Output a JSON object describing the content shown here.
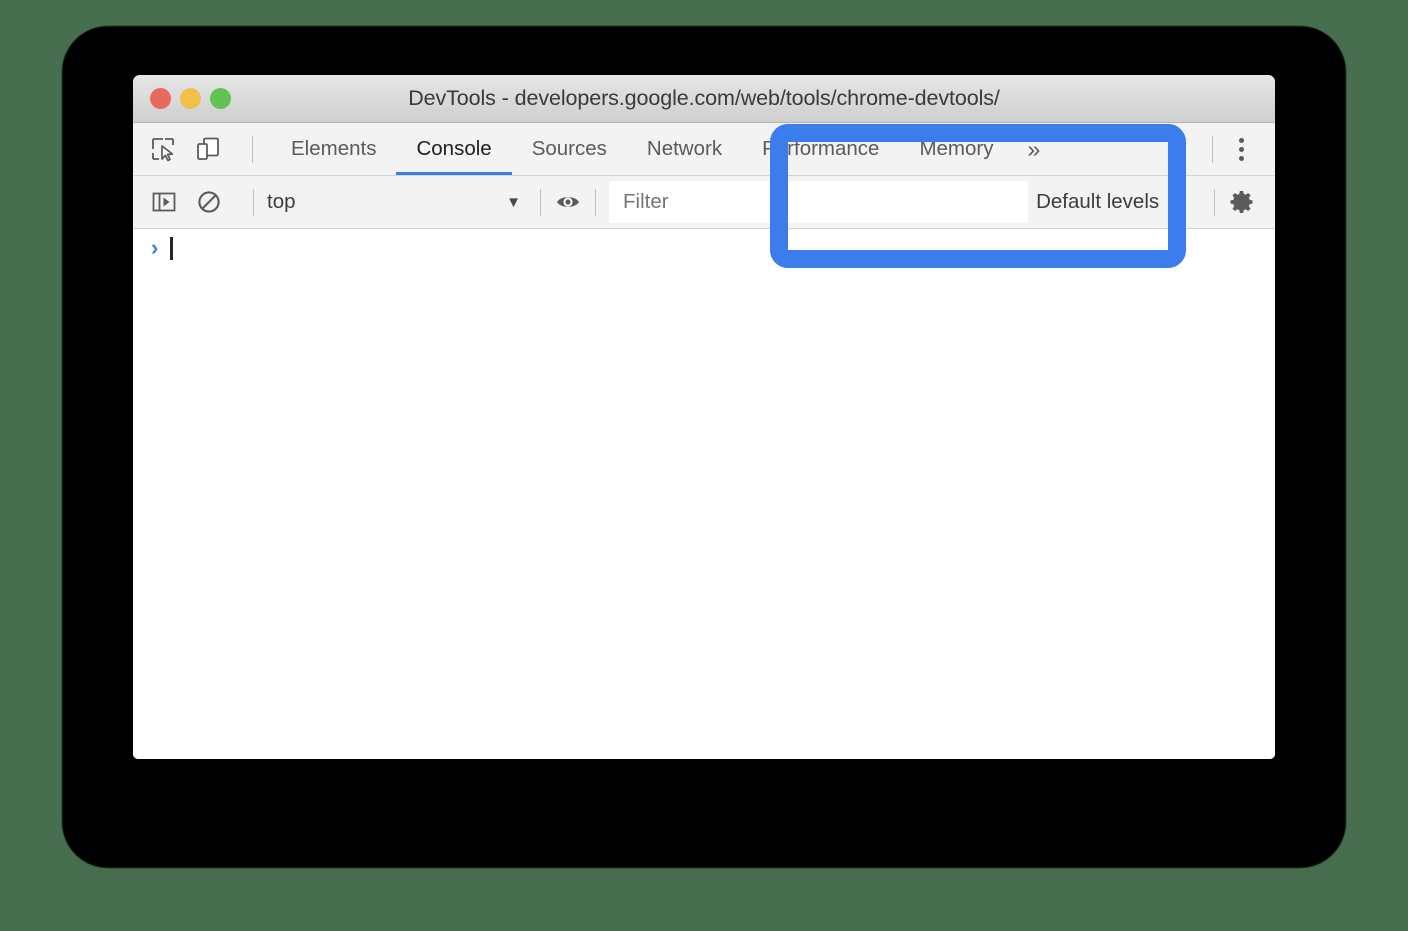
{
  "window": {
    "title": "DevTools - developers.google.com/web/tools/chrome-devtools/",
    "traffic_lights": [
      {
        "name": "close",
        "color": "#e8695e"
      },
      {
        "name": "minimize",
        "color": "#f0bf4c"
      },
      {
        "name": "zoom",
        "color": "#62c354"
      }
    ]
  },
  "toolbar": {
    "inspect_icon": "inspect-element-icon",
    "device_icon": "device-toolbar-icon",
    "overflow_label": "»",
    "kebab_icon": "more-options-icon",
    "tabs": [
      {
        "label": "Elements",
        "active": false
      },
      {
        "label": "Console",
        "active": true
      },
      {
        "label": "Sources",
        "active": false
      },
      {
        "label": "Network",
        "active": false
      },
      {
        "label": "Performance",
        "active": false
      },
      {
        "label": "Memory",
        "active": false
      }
    ]
  },
  "filterbar": {
    "sidebar_toggle_icon": "console-sidebar-icon",
    "clear_console_icon": "clear-console-icon",
    "context": {
      "value": "top",
      "caret": "▼"
    },
    "eye_icon": "live-expression-eye-icon",
    "filter": {
      "placeholder": "Filter",
      "value": ""
    },
    "levels": {
      "value": "Default levels",
      "caret": "▼"
    },
    "settings_icon": "settings-gear-icon"
  },
  "console": {
    "prompt_chevron": "›",
    "input_value": ""
  },
  "annotation": {
    "name": "highlight-box",
    "color": "#3b7ded"
  },
  "colors": {
    "page_background": "#476f4f",
    "shadow": "#000000",
    "accent": "#3b7ded",
    "chrome_panel": "#f3f3f3",
    "titlebar": "#d9d9d9"
  }
}
